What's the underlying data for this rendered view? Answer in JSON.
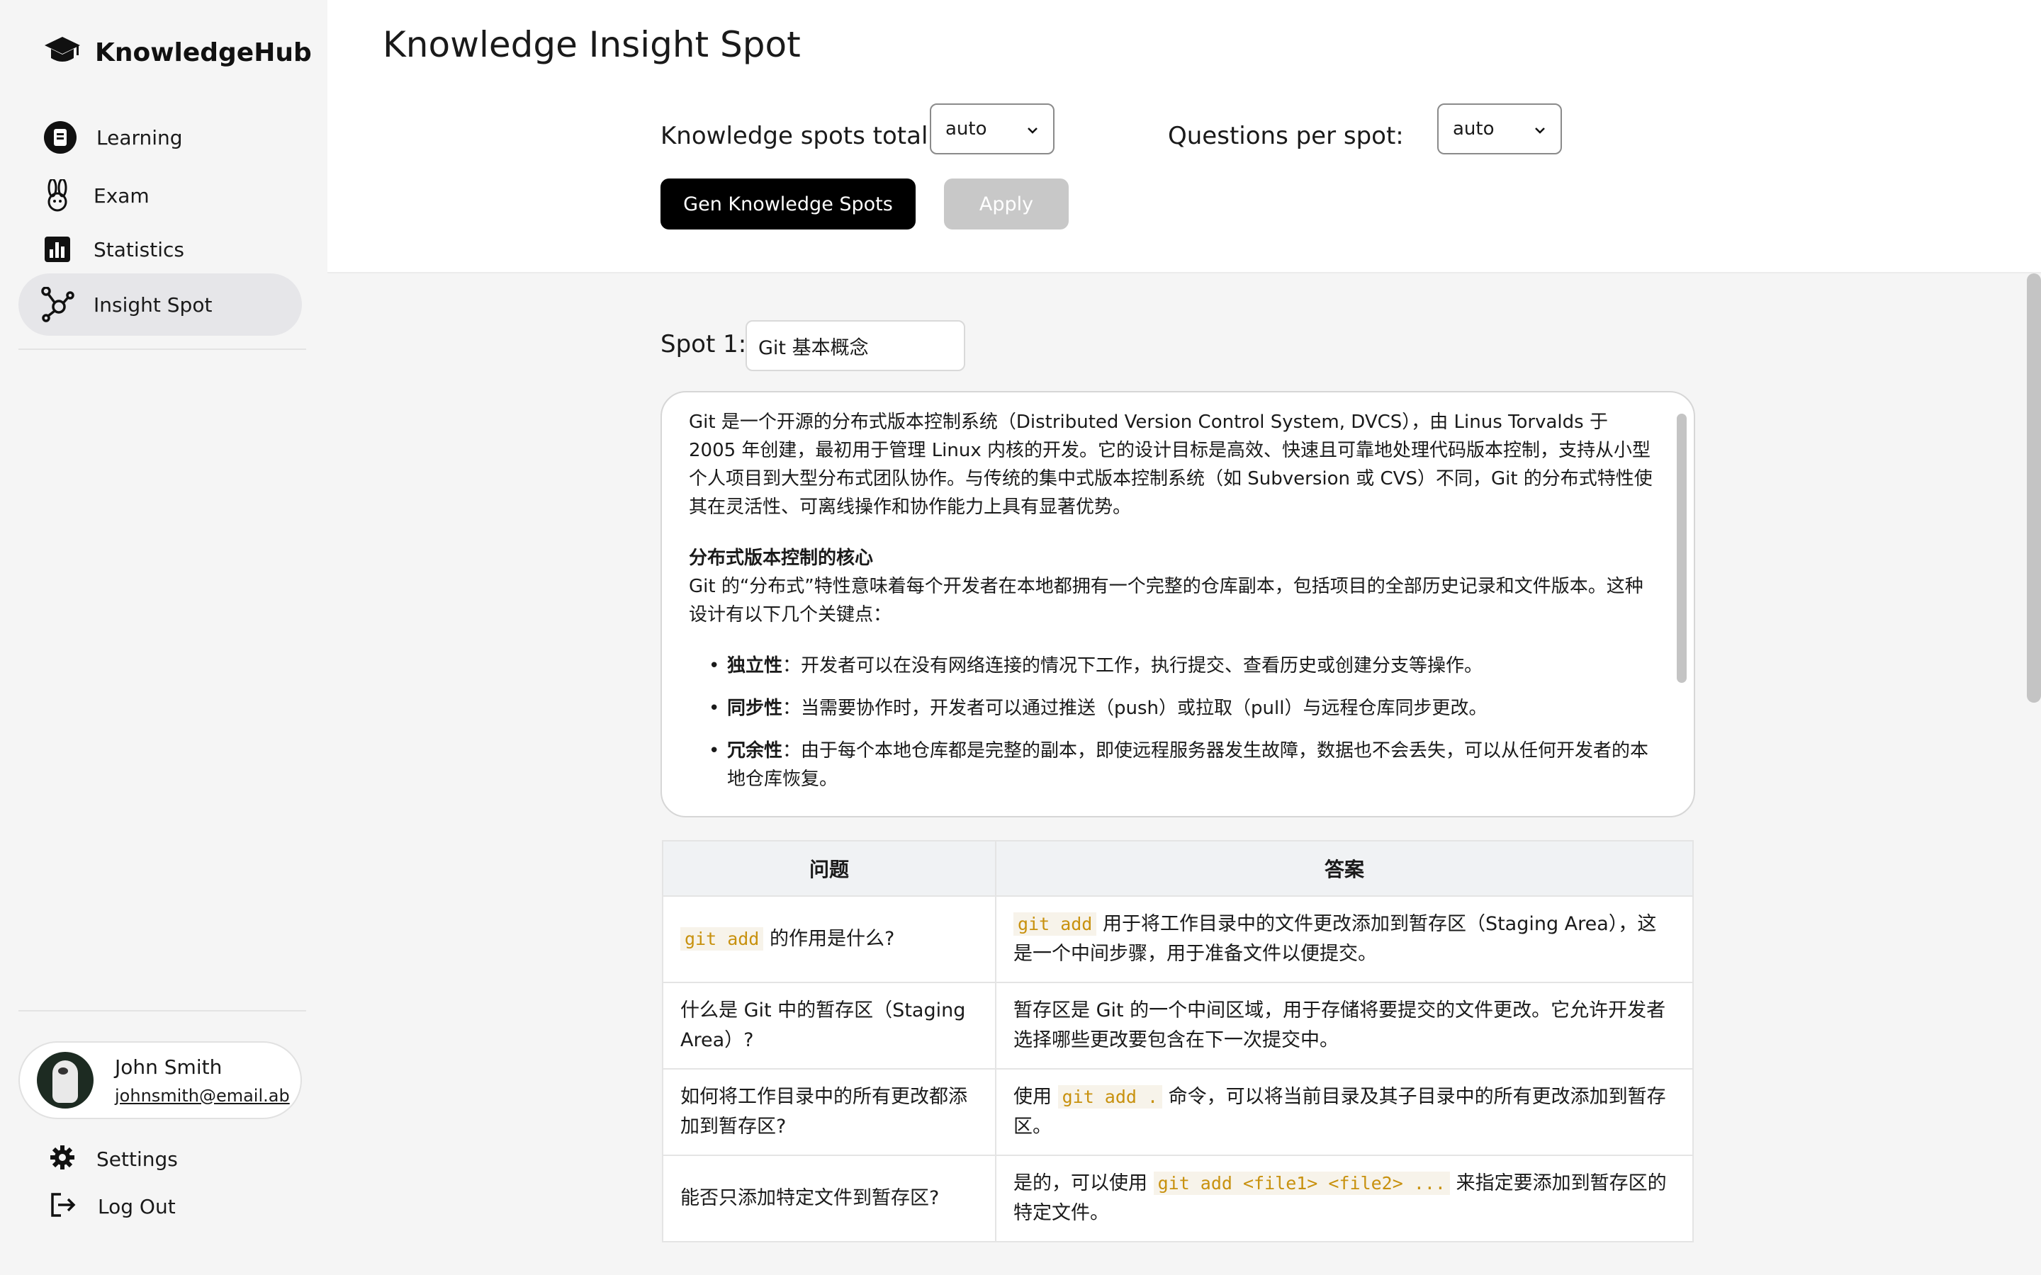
{
  "brand": {
    "name": "KnowledgeHub",
    "icon": "graduation-cap-icon"
  },
  "nav": [
    {
      "label": "Learning",
      "icon": "book-icon",
      "active": false
    },
    {
      "label": "Exam",
      "icon": "bunny-icon",
      "active": false
    },
    {
      "label": "Statistics",
      "icon": "bar-chart-icon",
      "active": false
    },
    {
      "label": "Insight Spot",
      "icon": "hub-icon",
      "active": true
    }
  ],
  "user": {
    "name": "John Smith",
    "email": "johnsmith@email.ab"
  },
  "bottom_links": {
    "settings": "Settings",
    "logout": "Log Out"
  },
  "header": {
    "title": "Knowledge Insight Spot",
    "spots_total_label": "Knowledge spots total:",
    "spots_total_value": "auto",
    "questions_label": "Questions per spot:",
    "questions_value": "auto",
    "gen_button": "Gen Knowledge Spots",
    "apply_button": "Apply"
  },
  "spot": {
    "label": "Spot 1:",
    "title": "Git 基本概念",
    "intro": "Git 是一个开源的分布式版本控制系统（Distributed Version Control System, DVCS），由 Linus Torvalds 于 2005 年创建，最初用于管理 Linux 内核的开发。它的设计目标是高效、快速且可靠地处理代码版本控制，支持从小型个人项目到大型分布式团队协作。与传统的集中式版本控制系统（如 Subversion 或 CVS）不同，Git 的分布式特性使其在灵活性、可离线操作和协作能力上具有显著优势。",
    "section_heading": "分布式版本控制的核心",
    "section_text": "Git 的“分布式”特性意味着每个开发者在本地都拥有一个完整的仓库副本，包括项目的全部历史记录和文件版本。这种设计有以下几个关键点：",
    "bullets": [
      {
        "term": "独立性",
        "text": "：开发者可以在没有网络连接的情况下工作，执行提交、查看历史或创建分支等操作。"
      },
      {
        "term": "同步性",
        "text": "：当需要协作时，开发者可以通过推送（push）或拉取（pull）与远程仓库同步更改。"
      },
      {
        "term": "冗余性",
        "text": "：由于每个本地仓库都是完整的副本，即使远程服务器发生故障，数据也不会丢失，可以从任何开发者的本地仓库恢复。"
      }
    ]
  },
  "table": {
    "headers": [
      "问题",
      "答案"
    ],
    "rows": [
      {
        "q_code": "git add",
        "q_text": " 的作用是什么?",
        "a_pre": "",
        "a_code": "git add",
        "a_text": " 用于将工作目录中的文件更改添加到暂存区（Staging Area），这是一个中间步骤，用于准备文件以便提交。"
      },
      {
        "q_code": "",
        "q_text": "什么是 Git 中的暂存区（Staging Area）?",
        "a_pre": "",
        "a_code": "",
        "a_text": "暂存区是 Git 的一个中间区域，用于存储将要提交的文件更改。它允许开发者选择哪些更改要包含在下一次提交中。"
      },
      {
        "q_code": "",
        "q_text": "如何将工作目录中的所有更改都添加到暂存区?",
        "a_pre": "使用 ",
        "a_code": "git add .",
        "a_text": " 命令，可以将当前目录及其子目录中的所有更改添加到暂存区。"
      },
      {
        "q_code": "",
        "q_text": "能否只添加特定文件到暂存区?",
        "a_pre": "是的，可以使用 ",
        "a_code": "git add <file1> <file2> ...",
        "a_text": " 来指定要添加到暂存区的特定文件。"
      }
    ]
  }
}
